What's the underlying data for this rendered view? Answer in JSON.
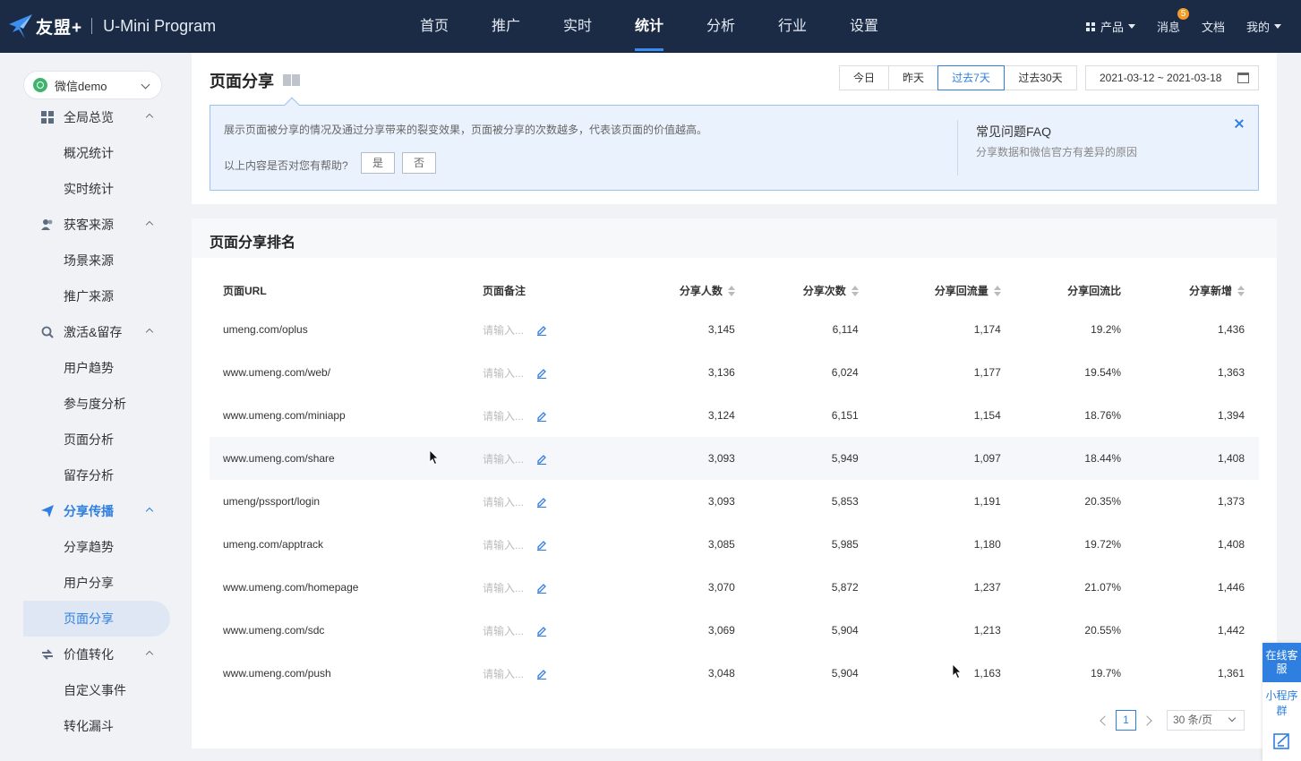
{
  "header": {
    "brand": "友盟+",
    "product": "U-Mini Program",
    "nav": [
      "首页",
      "推广",
      "实时",
      "统计",
      "分析",
      "行业",
      "设置"
    ],
    "active_nav": "统计",
    "products_label": "产品",
    "messages_label": "消息",
    "messages_badge": "5",
    "docs_label": "文档",
    "mine_label": "我的"
  },
  "sidebar": {
    "app_name": "微信demo",
    "groups": [
      {
        "label": "全局总览",
        "icon": "dashboard-icon",
        "items": [
          "概况统计",
          "实时统计"
        ]
      },
      {
        "label": "获客来源",
        "icon": "users-icon",
        "items": [
          "场景来源",
          "推广来源"
        ]
      },
      {
        "label": "激活&留存",
        "icon": "refresh-search-icon",
        "items": [
          "用户趋势",
          "参与度分析",
          "页面分析",
          "留存分析"
        ]
      },
      {
        "label": "分享传播",
        "icon": "send-icon",
        "items": [
          "分享趋势",
          "用户分享",
          "页面分享"
        ]
      },
      {
        "label": "价值转化",
        "icon": "exchange-icon",
        "items": [
          "自定义事件",
          "转化漏斗"
        ]
      }
    ],
    "active_group": "分享传播",
    "active_item": "页面分享"
  },
  "page": {
    "title": "页面分享",
    "date_tabs": [
      "今日",
      "昨天",
      "过去7天",
      "过去30天"
    ],
    "active_tab": "过去7天",
    "date_range": "2021-03-12 ~ 2021-03-18",
    "info_text": "展示页面被分享的情况及通过分享带来的裂变效果，页面被分享的次数越多，代表该页面的价值越高。",
    "help_question": "以上内容是否对您有帮助?",
    "help_yes": "是",
    "help_no": "否",
    "faq_title": "常见问题FAQ",
    "faq_desc": "分享数据和微信官方有差异的原因"
  },
  "ranking": {
    "title": "页面分享排名",
    "columns": [
      "页面URL",
      "页面备注",
      "分享人数",
      "分享次数",
      "分享回流量",
      "分享回流比",
      "分享新增"
    ],
    "note_placeholder": "请输入...",
    "rows": [
      [
        "umeng.com/oplus",
        "3,145",
        "6,114",
        "1,174",
        "19.2%",
        "1,436"
      ],
      [
        "www.umeng.com/web/",
        "3,136",
        "6,024",
        "1,177",
        "19.54%",
        "1,363"
      ],
      [
        "www.umeng.com/miniapp",
        "3,124",
        "6,151",
        "1,154",
        "18.76%",
        "1,394"
      ],
      [
        "www.umeng.com/share",
        "3,093",
        "5,949",
        "1,097",
        "18.44%",
        "1,408"
      ],
      [
        "umeng/pssport/login",
        "3,093",
        "5,853",
        "1,191",
        "20.35%",
        "1,373"
      ],
      [
        "umeng.com/apptrack",
        "3,085",
        "5,985",
        "1,180",
        "19.72%",
        "1,408"
      ],
      [
        "www.umeng.com/homepage",
        "3,070",
        "5,872",
        "1,237",
        "21.07%",
        "1,446"
      ],
      [
        "www.umeng.com/sdc",
        "3,069",
        "5,904",
        "1,213",
        "20.55%",
        "1,442"
      ],
      [
        "www.umeng.com/push",
        "3,048",
        "5,904",
        "1,163",
        "19.7%",
        "1,361"
      ]
    ],
    "page_current": "1",
    "page_size": "30 条/页"
  },
  "float": {
    "service": "在线客服",
    "group": "小程序群"
  },
  "colors": {
    "accent": "#2f7fe0",
    "topbar": "#1b2b46",
    "badge": "#f29b26"
  }
}
